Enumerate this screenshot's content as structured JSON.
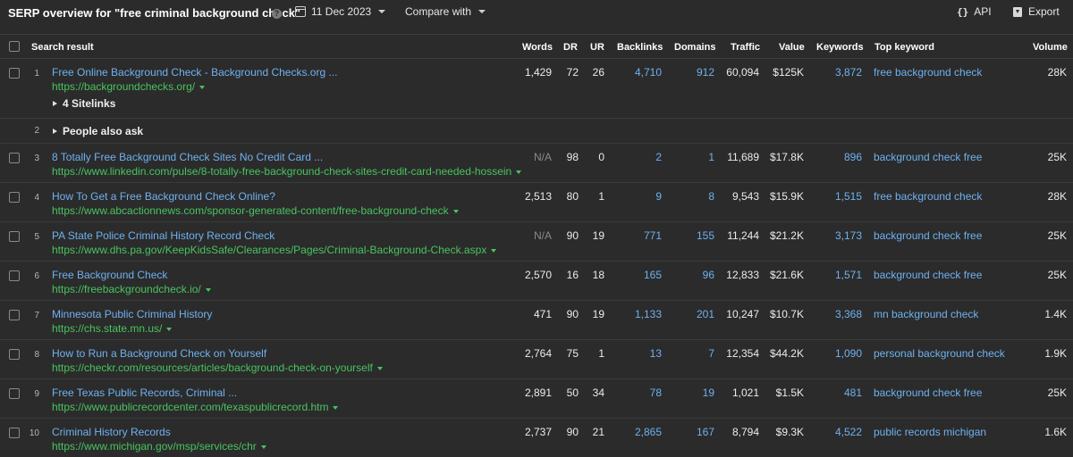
{
  "header": {
    "title": "SERP overview for \"free criminal background check\"",
    "help_icon": "question-circle-icon",
    "date": "11 Dec 2023",
    "compare": "Compare with",
    "api": "API",
    "api_icon": "{}",
    "export": "Export"
  },
  "columns": {
    "search_result": "Search result",
    "words": "Words",
    "dr": "DR",
    "ur": "UR",
    "backlinks": "Backlinks",
    "domains": "Domains",
    "traffic": "Traffic",
    "value": "Value",
    "keywords": "Keywords",
    "top_keyword": "Top keyword",
    "volume": "Volume"
  },
  "sitelinks_label": "4 Sitelinks",
  "paa": {
    "num": "2",
    "label": "People also ask"
  },
  "results": [
    {
      "num": "1",
      "title": "Free Online Background Check - Background Checks.org ...",
      "url": "https://backgroundchecks.org/",
      "words": "1,429",
      "dr": "72",
      "ur": "26",
      "backlinks": "4,710",
      "domains": "912",
      "traffic": "60,094",
      "value": "$125K",
      "keywords": "3,872",
      "top_keyword": "free background check",
      "volume": "28K"
    },
    {
      "num": "3",
      "title": "8 Totally Free Background Check Sites No Credit Card ...",
      "url": "https://www.linkedin.com/pulse/8-totally-free-background-check-sites-credit-card-needed-hossein",
      "words": "N/A",
      "dr": "98",
      "ur": "0",
      "backlinks": "2",
      "domains": "1",
      "traffic": "11,689",
      "value": "$17.8K",
      "keywords": "896",
      "top_keyword": "background check free",
      "volume": "25K"
    },
    {
      "num": "4",
      "title": "How To Get a Free Background Check Online?",
      "url": "https://www.abcactionnews.com/sponsor-generated-content/free-background-check",
      "words": "2,513",
      "dr": "80",
      "ur": "1",
      "backlinks": "9",
      "domains": "8",
      "traffic": "9,543",
      "value": "$15.9K",
      "keywords": "1,515",
      "top_keyword": "free background check",
      "volume": "28K"
    },
    {
      "num": "5",
      "title": "PA State Police Criminal History Record Check",
      "url": "https://www.dhs.pa.gov/KeepKidsSafe/Clearances/Pages/Criminal-Background-Check.aspx",
      "words": "N/A",
      "dr": "90",
      "ur": "19",
      "backlinks": "771",
      "domains": "155",
      "traffic": "11,244",
      "value": "$21.2K",
      "keywords": "3,173",
      "top_keyword": "background check free",
      "volume": "25K"
    },
    {
      "num": "6",
      "title": "Free Background Check",
      "url": "https://freebackgroundcheck.io/",
      "words": "2,570",
      "dr": "16",
      "ur": "18",
      "backlinks": "165",
      "domains": "96",
      "traffic": "12,833",
      "value": "$21.6K",
      "keywords": "1,571",
      "top_keyword": "background check free",
      "volume": "25K"
    },
    {
      "num": "7",
      "title": "Minnesota Public Criminal History",
      "url": "https://chs.state.mn.us/",
      "words": "471",
      "dr": "90",
      "ur": "19",
      "backlinks": "1,133",
      "domains": "201",
      "traffic": "10,247",
      "value": "$10.7K",
      "keywords": "3,368",
      "top_keyword": "mn background check",
      "volume": "1.4K"
    },
    {
      "num": "8",
      "title": "How to Run a Background Check on Yourself",
      "url": "https://checkr.com/resources/articles/background-check-on-yourself",
      "words": "2,764",
      "dr": "75",
      "ur": "1",
      "backlinks": "13",
      "domains": "7",
      "traffic": "12,354",
      "value": "$44.2K",
      "keywords": "1,090",
      "top_keyword": "personal background check",
      "volume": "1.9K"
    },
    {
      "num": "9",
      "title": "Free Texas Public Records, Criminal ...",
      "url": "https://www.publicrecordcenter.com/texaspublicrecord.htm",
      "words": "2,891",
      "dr": "50",
      "ur": "34",
      "backlinks": "78",
      "domains": "19",
      "traffic": "1,021",
      "value": "$1.5K",
      "keywords": "481",
      "top_keyword": "background check free",
      "volume": "25K"
    },
    {
      "num": "10",
      "title": "Criminal History Records",
      "url": "https://www.michigan.gov/msp/services/chr",
      "words": "2,737",
      "dr": "90",
      "ur": "21",
      "backlinks": "2,865",
      "domains": "167",
      "traffic": "8,794",
      "value": "$9.3K",
      "keywords": "4,522",
      "top_keyword": "public records michigan",
      "volume": "1.6K"
    }
  ]
}
